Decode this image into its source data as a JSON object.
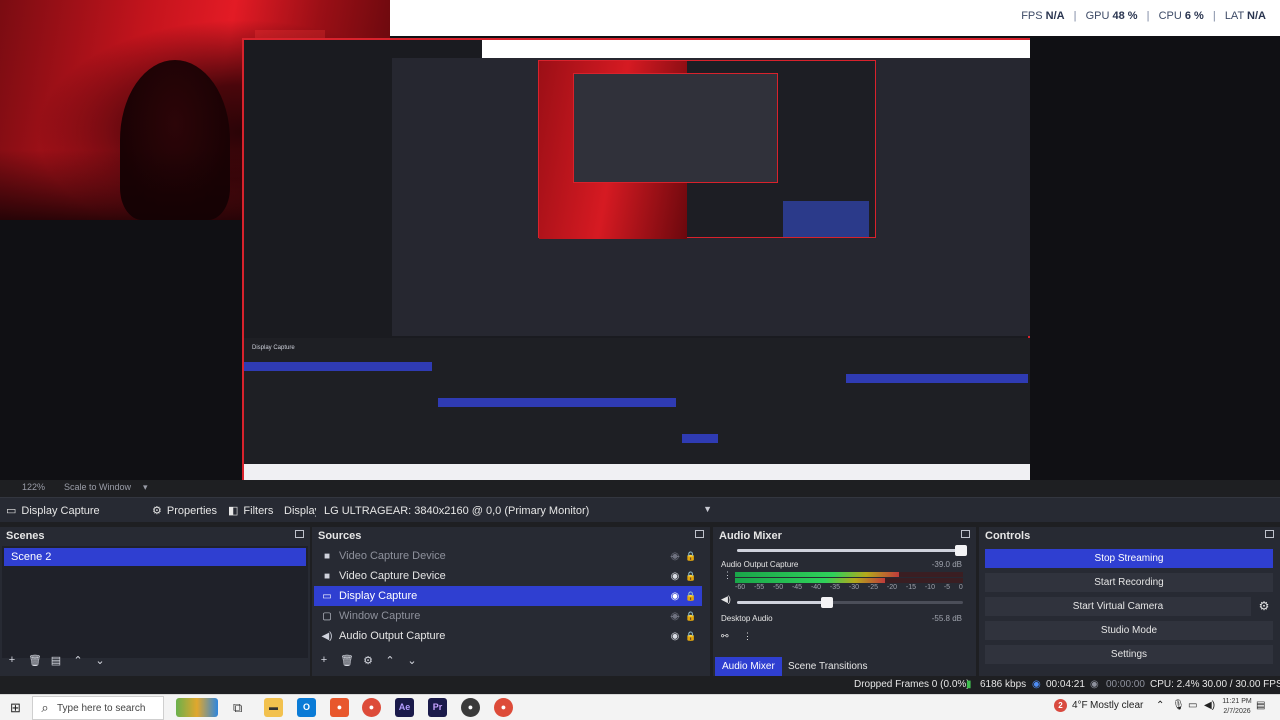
{
  "preview": {
    "stats": {
      "fps_label": "FPS",
      "fps_value": "N/A",
      "gpu_label": "GPU",
      "gpu_value": "48 %",
      "cpu_label": "CPU",
      "cpu_value": "6 %",
      "lat_label": "LAT",
      "lat_value": "N/A"
    },
    "zoom_level": "122%",
    "scale_mode": "Scale to Window"
  },
  "source_toolbar": {
    "source_name": "Display Capture",
    "properties_label": "Properties",
    "filters_label": "Filters",
    "display_label": "Display",
    "display_value": "LG ULTRAGEAR: 3840x2160 @ 0,0 (Primary Monitor)"
  },
  "scenes": {
    "title": "Scenes",
    "items": [
      {
        "label": "Scene 2",
        "selected": true
      }
    ]
  },
  "sources": {
    "title": "Sources",
    "items": [
      {
        "label": "Video Capture Device",
        "icon": "camera-icon",
        "visible": false
      },
      {
        "label": "Video Capture Device",
        "icon": "camera-icon",
        "visible": true
      },
      {
        "label": "Display Capture",
        "icon": "monitor-icon",
        "visible": true,
        "selected": true
      },
      {
        "label": "Window Capture",
        "icon": "window-icon",
        "visible": false
      },
      {
        "label": "Audio Output Capture",
        "icon": "speaker-icon",
        "visible": true
      }
    ]
  },
  "audio_mixer": {
    "title": "Audio Mixer",
    "channels": [
      {
        "name": "Audio Output Capture",
        "db": "-39.0 dB",
        "level": 0.72,
        "volume": 1.0
      },
      {
        "name": "Desktop Audio",
        "db": "-55.8 dB",
        "level": 0.0
      }
    ],
    "scale": [
      "-60",
      "-55",
      "-50",
      "-45",
      "-40",
      "-35",
      "-30",
      "-25",
      "-20",
      "-15",
      "-10",
      "-5",
      "0"
    ],
    "tabs": [
      "Audio Mixer",
      "Scene Transitions"
    ]
  },
  "controls": {
    "title": "Controls",
    "buttons": [
      "Stop Streaming",
      "Start Recording",
      "Start Virtual Camera",
      "Studio Mode",
      "Settings"
    ]
  },
  "status_bar": {
    "dropped_frames": "Dropped Frames 0 (0.0%)",
    "bitrate": "6186 kbps",
    "stream_time": "00:04:21",
    "record_time": "00:00:00",
    "cpu": "CPU: 2.4%",
    "fps": "30.00 / 30.00 FPS"
  },
  "taskbar": {
    "search_placeholder": "Type here to search",
    "weather_temp": "4°F",
    "weather_text": "Mostly clear",
    "time": "11:21 PM",
    "date": "2/7/2026",
    "notification_count": "2"
  },
  "colors": {
    "accent": "#2f3fd1",
    "panel": "#272a33",
    "preview_border": "#d8222c"
  }
}
